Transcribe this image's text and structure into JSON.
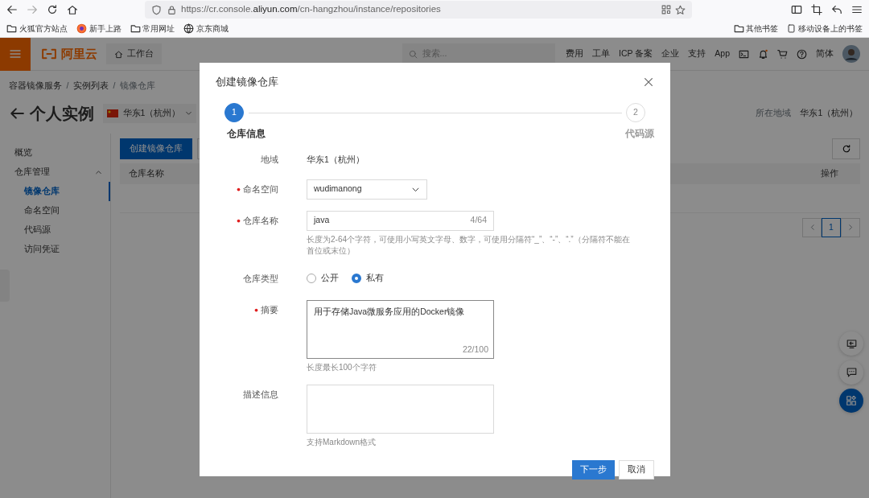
{
  "browser": {
    "url": {
      "before": "https://cr.console.",
      "domain": "aliyun.com",
      "after": "/cn-hangzhou/instance/repositories"
    },
    "bookmarks": [
      {
        "label": "火狐官方站点",
        "kind": "folder"
      },
      {
        "label": "新手上路",
        "kind": "firefox"
      },
      {
        "label": "常用网址",
        "kind": "folder"
      },
      {
        "label": "京东商城",
        "kind": "globe"
      }
    ],
    "bookmarks_right": [
      {
        "label": "其他书签",
        "kind": "folder"
      },
      {
        "label": "移动设备上的书签",
        "kind": "mobile"
      }
    ]
  },
  "console_nav": {
    "logo": "阿里云",
    "workbench": "工作台",
    "search": {
      "placeholder": "搜索..."
    },
    "links": [
      "费用",
      "工单",
      "ICP 备案",
      "企业",
      "支持",
      "App"
    ],
    "language": "简体"
  },
  "breadcrumb": {
    "separator": "/",
    "items": [
      "容器镜像服务",
      "实例列表",
      "镜像仓库"
    ]
  },
  "page_title": "个人实例",
  "region_select": "华东1（杭州）",
  "region_label": "所在地域",
  "region_value": "华东1（杭州）",
  "sidebar": {
    "items": [
      {
        "label": "概览"
      },
      {
        "label": "仓库管理",
        "expanded": true,
        "children": [
          {
            "label": "镜像仓库",
            "selected": true
          },
          {
            "label": "命名空间",
            "selected": false
          },
          {
            "label": "代码源",
            "selected": false
          },
          {
            "label": "访问凭证",
            "selected": false
          }
        ]
      }
    ]
  },
  "toolbar": {
    "create_button": "创建镜像仓库"
  },
  "table": {
    "columns": [
      "仓库名称",
      "操作"
    ]
  },
  "pagination": [
    {
      "label": "1",
      "selected": true
    }
  ],
  "modal": {
    "title": "创建镜像仓库",
    "steps": [
      {
        "number": "1",
        "label": "仓库信息",
        "selected": true
      },
      {
        "number": "2",
        "label": "代码源",
        "selected": false
      }
    ],
    "fields": [
      {
        "kind": "static",
        "label": "地域",
        "required": false,
        "value": "华东1（杭州）"
      },
      {
        "kind": "select",
        "label": "命名空间",
        "required": true,
        "value": "wudimanong"
      },
      {
        "kind": "input",
        "label": "仓库名称",
        "required": true,
        "value": "java",
        "counter": "4/64",
        "help": "长度为2-64个字符，可使用小写英文字母、数字，可使用分隔符“_”、“-”、“.”（分隔符不能在首位或末位）"
      },
      {
        "kind": "radio",
        "label": "仓库类型",
        "required": false,
        "options": [
          {
            "label": "公开",
            "selected": false
          },
          {
            "label": "私有",
            "selected": true
          }
        ]
      },
      {
        "kind": "textarea",
        "label": "摘要",
        "required": true,
        "value": "用于存储Java微服务应用的Docker镜像",
        "counter": "22/100",
        "help": "长度最长100个字符"
      },
      {
        "kind": "textarea",
        "label": "描述信息",
        "required": false,
        "help": "支持Markdown格式"
      }
    ],
    "buttons": [
      {
        "label": "下一步",
        "kind": "primary"
      },
      {
        "label": "取消",
        "kind": "secondary"
      }
    ]
  }
}
